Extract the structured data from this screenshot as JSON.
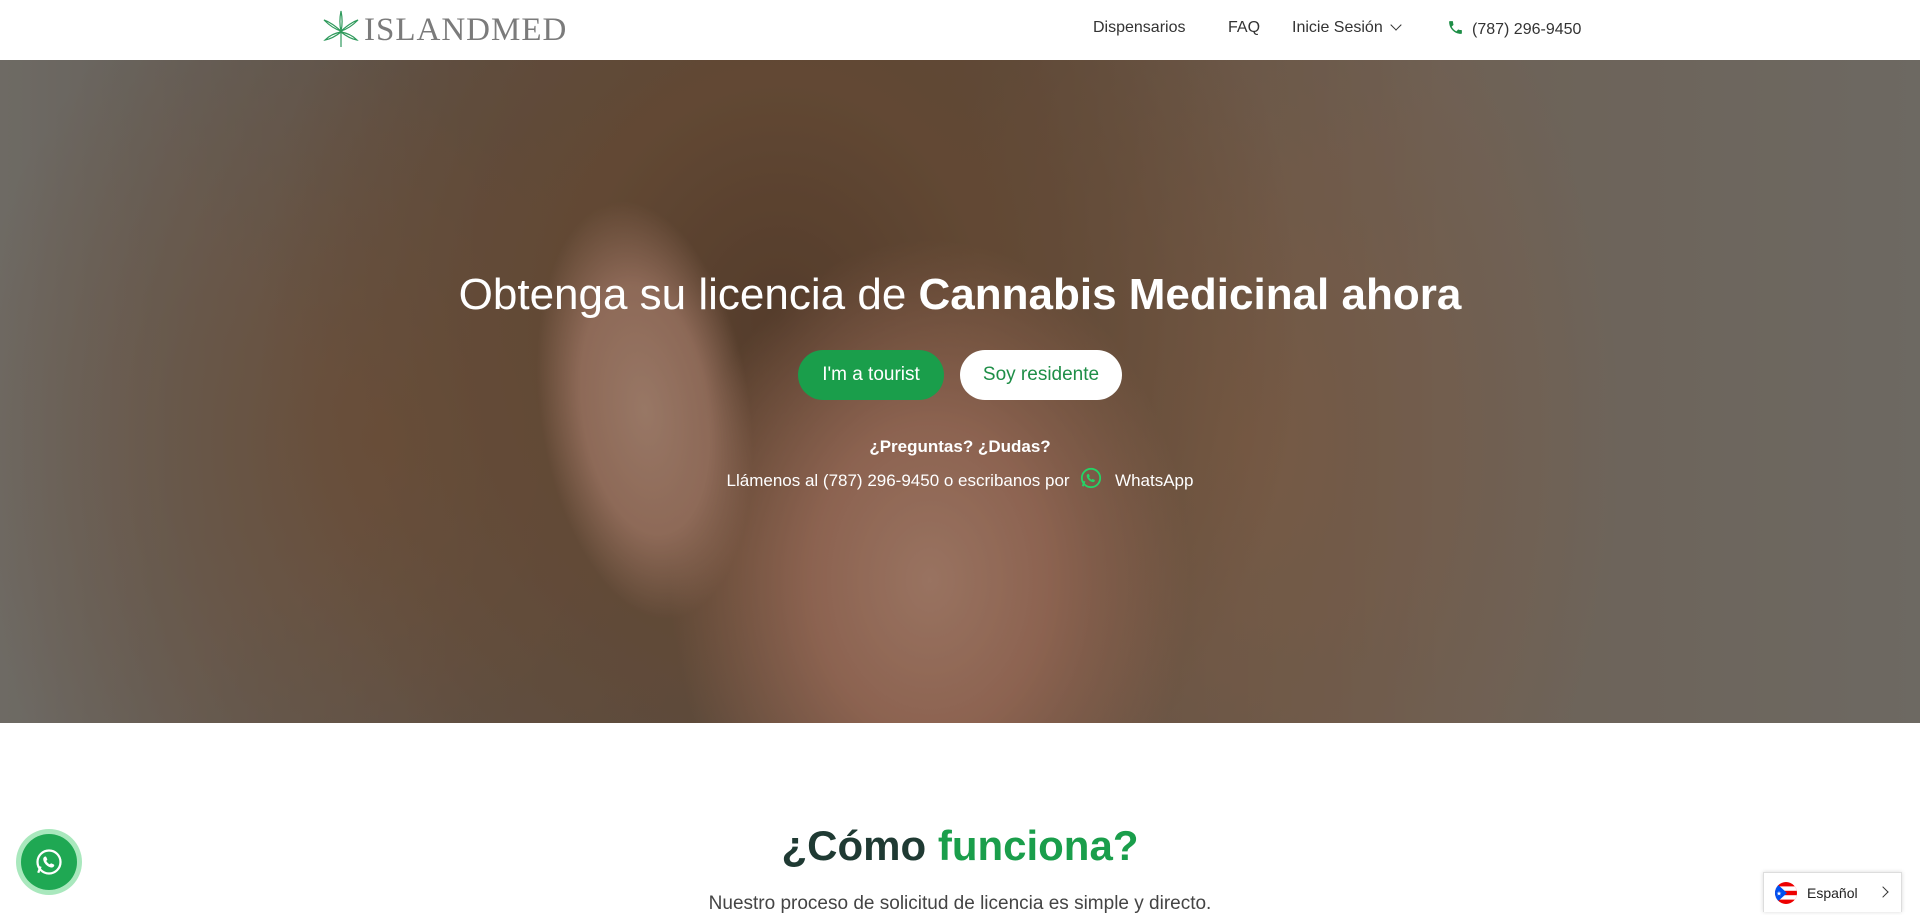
{
  "header": {
    "logo_text": "ISLANDMED",
    "nav": {
      "dispensarios": "Dispensarios",
      "faq": "FAQ",
      "login": "Inicie Sesión",
      "phone": "(787) 296-9450"
    }
  },
  "hero": {
    "title_regular": "Obtenga su licencia de ",
    "title_bold": "Cannabis Medicinal ahora",
    "btn_tourist": "I'm a tourist",
    "btn_resident": "Soy residente",
    "questions": "¿Preguntas? ¿Dudas?",
    "call_text": "Llámenos al (787) 296-9450 o escribanos por",
    "whatsapp": "WhatsApp"
  },
  "section": {
    "title_part1": "¿Cómo ",
    "title_part2": "funciona?",
    "subtitle": "Nuestro proceso de solicitud de licencia es simple y directo."
  },
  "language": {
    "label": "Español"
  },
  "icons": {
    "logo": "cannabis-leaf-icon",
    "phone": "phone-icon",
    "whatsapp": "whatsapp-icon",
    "flag": "puerto-rico-flag-icon"
  },
  "colors": {
    "brand_green": "#1a9e4b",
    "title_dark": "#1f3a33",
    "whatsapp_bg": "#1fa853"
  }
}
